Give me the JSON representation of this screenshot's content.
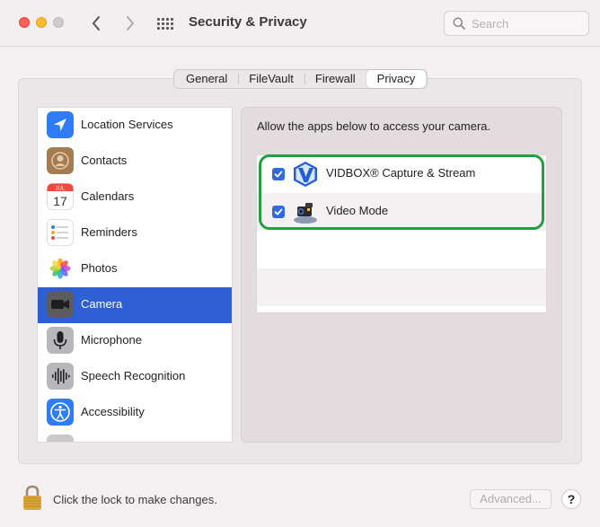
{
  "window": {
    "title": "Security & Privacy",
    "search_placeholder": "Search"
  },
  "tabs": [
    {
      "label": "General",
      "active": false
    },
    {
      "label": "FileVault",
      "active": false
    },
    {
      "label": "Firewall",
      "active": false
    },
    {
      "label": "Privacy",
      "active": true
    }
  ],
  "sidebar": {
    "items": [
      {
        "label": "Location Services",
        "icon": "location-arrow-icon"
      },
      {
        "label": "Contacts",
        "icon": "contacts-icon"
      },
      {
        "label": "Calendars",
        "icon": "calendar-icon",
        "icon_month": "JUL",
        "icon_day": "17"
      },
      {
        "label": "Reminders",
        "icon": "reminders-icon"
      },
      {
        "label": "Photos",
        "icon": "photos-icon"
      },
      {
        "label": "Camera",
        "icon": "camera-icon",
        "selected": true
      },
      {
        "label": "Microphone",
        "icon": "microphone-icon"
      },
      {
        "label": "Speech Recognition",
        "icon": "waveform-icon"
      },
      {
        "label": "Accessibility",
        "icon": "accessibility-icon"
      }
    ]
  },
  "pane": {
    "description": "Allow the apps below to access your camera.",
    "apps": [
      {
        "name": "VIDBOX® Capture & Stream",
        "checked": true,
        "icon": "vidbox-logo-icon"
      },
      {
        "name": "Video Mode",
        "checked": true,
        "icon": "video-camera-app-icon"
      }
    ]
  },
  "footer": {
    "lock_text": "Click the lock to make changes.",
    "advanced_label": "Advanced...",
    "help_label": "?"
  },
  "colors": {
    "selection": "#2e60d3",
    "checkbox": "#2f6ae0",
    "highlight": "#22a040"
  }
}
